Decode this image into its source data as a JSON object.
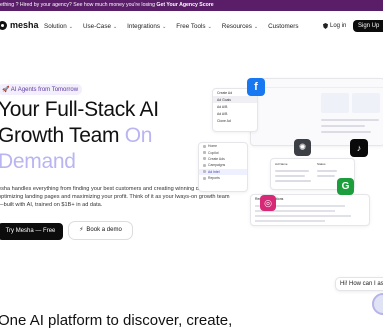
{
  "promo": {
    "text": "ething ? Hired by your agency? See how much money you're losing ",
    "cta": "Get Your Agency Score"
  },
  "brand": {
    "name": "mesha"
  },
  "nav": {
    "items": [
      {
        "label": "Solution"
      },
      {
        "label": "Use-Case"
      },
      {
        "label": "Integrations"
      },
      {
        "label": "Free Tools"
      },
      {
        "label": "Resources"
      },
      {
        "label": "Customers"
      }
    ],
    "login": "Log in",
    "signup": "Sign Up"
  },
  "hero": {
    "badge": "🚀 AI Agents from Tomorrow",
    "title_line1": "Your Full-Stack AI",
    "title_line2": "Growth Team ",
    "title_accent": "On",
    "title_line3": "Demand",
    "subtitle": "esha handles everything from finding your best customers and creating winning ds, to optimizing landing pages and maximizing your profit. Think of it as your lways-on growth team—built with AI, trained on $1B+ in ad data.",
    "cta_primary": "Try Mesha — Free",
    "cta_secondary": "Book a demo"
  },
  "collage": {
    "dropdown": [
      "Create Ad",
      "Ad Goals",
      "Ad A/B",
      "Ad A/B",
      "Clone Ad"
    ],
    "sidebar": [
      "Home",
      "Copilot",
      "Create Ads",
      "Campaigns",
      "Ad Intel",
      "Reports"
    ],
    "grid_cols": [
      "Ad Name",
      "Status"
    ],
    "report_title": "Recommendations"
  },
  "chat": {
    "greeting": "Hi! How can I assist"
  },
  "bottom": {
    "heading": "One AI platform to discover, create,"
  },
  "colors": {
    "promo_bg": "#5a1e68",
    "accent": "#b9b5f2",
    "cta_bg": "#0c0c0c"
  }
}
